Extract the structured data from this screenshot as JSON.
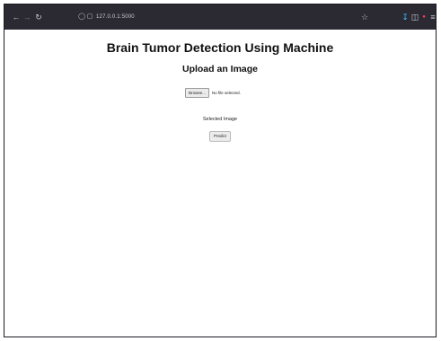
{
  "browser": {
    "url": "127.0.0.1:5000"
  },
  "page": {
    "title": "Brain Tumor Detection Using Machine",
    "upload_heading": "Upload an Image",
    "file_input": {
      "button_label": "Browse...",
      "status_text": "No file selected."
    },
    "selected_image_label": "Selected Image",
    "predict_label": "Predict"
  },
  "colors": {
    "toolbar_bg": "#2b2a33",
    "page_bg": "#ffffff",
    "download_icon": "#3fb6ff",
    "recording_dot": "#ff3a5c"
  },
  "icons": {
    "back": "back-arrow-icon",
    "forward": "forward-arrow-icon",
    "reload": "reload-icon",
    "shield": "shield-icon",
    "page": "page-icon",
    "bookmark": "star-icon",
    "download": "download-icon",
    "extensions": "extensions-icon",
    "menu": "hamburger-menu-icon"
  }
}
